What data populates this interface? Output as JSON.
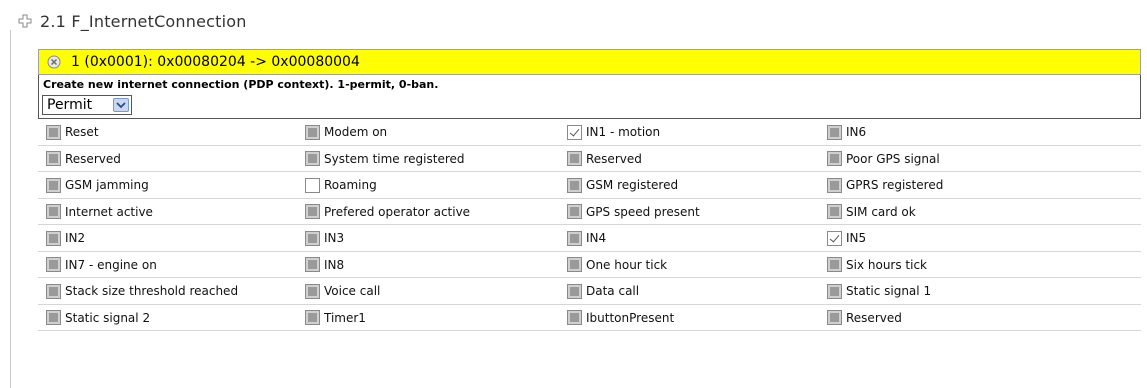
{
  "section": {
    "title": "2.1 F_InternetConnection",
    "icon": "plus-icon"
  },
  "rule": {
    "title": "1 (0x0001): 0x00080204 -> 0x00080004",
    "close_icon": "close-icon",
    "bar_color": "#ffff00",
    "description": "Create new internet connection (PDP context). 1-permit, 0-ban.",
    "select": {
      "value": "Permit"
    }
  },
  "flags": [
    [
      {
        "label": "Reset",
        "state": "inactive"
      },
      {
        "label": "Modem on",
        "state": "inactive"
      },
      {
        "label": "IN1 - motion",
        "state": "checked"
      },
      {
        "label": "IN6",
        "state": "inactive"
      }
    ],
    [
      {
        "label": "Reserved",
        "state": "inactive"
      },
      {
        "label": "System time registered",
        "state": "inactive"
      },
      {
        "label": "Reserved",
        "state": "inactive"
      },
      {
        "label": "Poor GPS signal",
        "state": "inactive"
      }
    ],
    [
      {
        "label": "GSM jamming",
        "state": "inactive"
      },
      {
        "label": "Roaming",
        "state": "empty"
      },
      {
        "label": "GSM registered",
        "state": "inactive"
      },
      {
        "label": "GPRS registered",
        "state": "inactive"
      }
    ],
    [
      {
        "label": "Internet active",
        "state": "inactive"
      },
      {
        "label": "Prefered operator active",
        "state": "inactive"
      },
      {
        "label": "GPS speed present",
        "state": "inactive"
      },
      {
        "label": "SIM card ok",
        "state": "inactive"
      }
    ],
    [
      {
        "label": "IN2",
        "state": "inactive"
      },
      {
        "label": "IN3",
        "state": "inactive"
      },
      {
        "label": "IN4",
        "state": "inactive"
      },
      {
        "label": "IN5",
        "state": "checked"
      }
    ],
    [
      {
        "label": "IN7 - engine on",
        "state": "inactive"
      },
      {
        "label": "IN8",
        "state": "inactive"
      },
      {
        "label": "One hour tick",
        "state": "inactive"
      },
      {
        "label": "Six hours tick",
        "state": "inactive"
      }
    ],
    [
      {
        "label": "Stack size threshold reached",
        "state": "inactive"
      },
      {
        "label": "Voice call",
        "state": "inactive"
      },
      {
        "label": "Data call",
        "state": "inactive"
      },
      {
        "label": "Static signal 1",
        "state": "inactive"
      }
    ],
    [
      {
        "label": "Static signal 2",
        "state": "inactive"
      },
      {
        "label": "Timer1",
        "state": "inactive"
      },
      {
        "label": "IbuttonPresent",
        "state": "inactive"
      },
      {
        "label": "Reserved",
        "state": "inactive"
      }
    ]
  ]
}
